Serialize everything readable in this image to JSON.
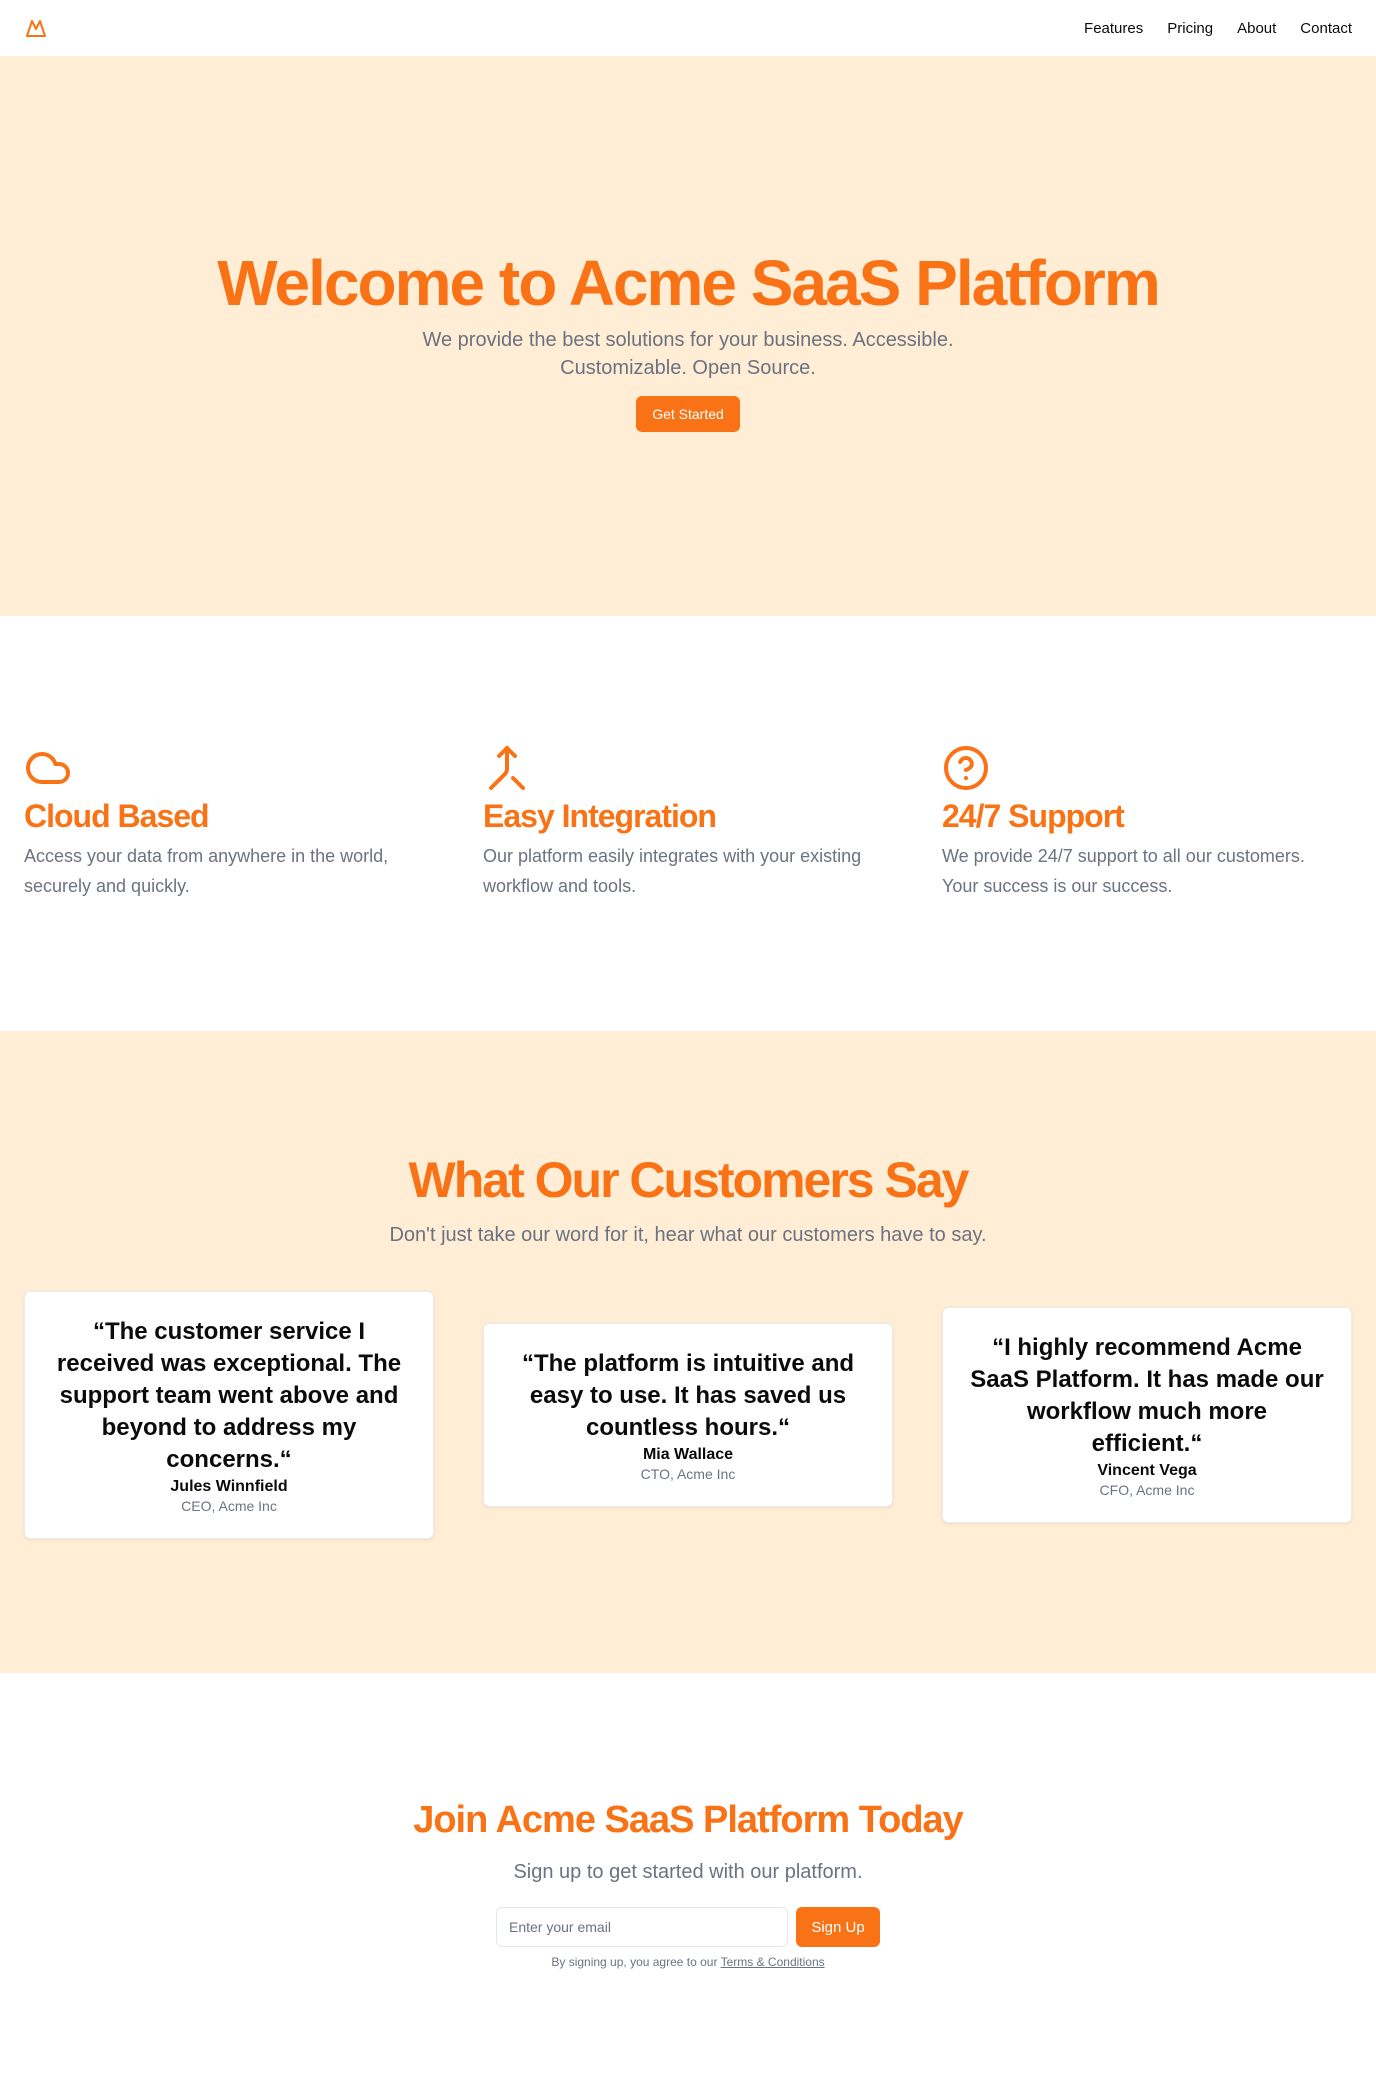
{
  "nav": {
    "links": [
      "Features",
      "Pricing",
      "About",
      "Contact"
    ]
  },
  "hero": {
    "title": "Welcome to Acme SaaS Platform",
    "subtitle_line1": "We provide the best solutions for your business. Accessible.",
    "subtitle_line2": "Customizable. Open Source.",
    "cta": "Get Started"
  },
  "features": [
    {
      "icon": "cloud-icon",
      "title": "Cloud Based",
      "line1": "Access your data from anywhere in the world,",
      "line2": "securely and quickly."
    },
    {
      "icon": "merge-icon",
      "title": "Easy Integration",
      "line1": "Our platform easily integrates with your existing",
      "line2": "workflow and tools."
    },
    {
      "icon": "help-circle-icon",
      "title": "24/7 Support",
      "line1": "We provide 24/7 support to all our customers.",
      "line2": "Your success is our success."
    }
  ],
  "testimonials": {
    "title": "What Our Customers Say",
    "subtitle": "Don't just take our word for it, hear what our customers have to say.",
    "cards": [
      {
        "quote": "“The customer service I received was exceptional. The support team went above and beyond to address my concerns.“",
        "name": "Jules Winnfield",
        "role": "CEO, Acme Inc"
      },
      {
        "quote": "“The platform is intuitive and easy to use. It has saved us countless hours.“",
        "name": "Mia Wallace",
        "role": "CTO, Acme Inc"
      },
      {
        "quote": "“I highly recommend Acme SaaS Platform. It has made our workflow much more efficient.“",
        "name": "Vincent Vega",
        "role": "CFO, Acme Inc"
      }
    ]
  },
  "join": {
    "title": "Join Acme SaaS Platform Today",
    "subtitle": "Sign up to get started with our platform.",
    "email_placeholder": "Enter your email",
    "button": "Sign Up",
    "fine_print": "By signing up, you agree to our",
    "terms_link": "Terms & Conditions"
  },
  "colors": {
    "accent": "#f97316",
    "hero_bg": "#ffedd5",
    "muted_text": "#6b7280"
  }
}
